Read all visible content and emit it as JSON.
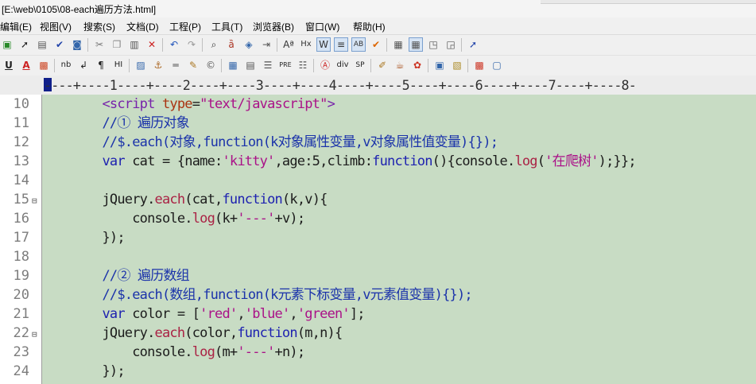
{
  "window": {
    "title": "[E:\\web\\0105\\08-each遍历方法.html]"
  },
  "menu": [
    "编辑(E)",
    "视图(V)",
    "搜索(S)",
    "文档(D)",
    "工程(P)",
    "工具(T)",
    "浏览器(B)",
    "窗口(W)",
    "帮助(H)"
  ],
  "toolbar_labels": {
    "nb": "nb",
    "p": "¶",
    "hi": "HI",
    "pre": "PRE",
    "div": "div",
    "sp": "SP",
    "a": "A",
    "u": "U",
    "hx": "Hx"
  },
  "ruler": "----+----1----+----2----+----3----+----4----+----5----+----6----+----7----+----8-",
  "line_numbers": [
    "10",
    "11",
    "12",
    "13",
    "14",
    "15",
    "16",
    "17",
    "18",
    "19",
    "20",
    "21",
    "22",
    "23",
    "24"
  ],
  "code": {
    "l10_open": "<script",
    "l10_attr": "type",
    "l10_eq": "=",
    "l10_val": "\"text/javascript\"",
    "l10_close": ">",
    "l11": "//① 遍历对象",
    "l12": "//$.each(对象,function(k对象属性变量,v对象属性值变量){});",
    "l13_kw": "var",
    "l13_a": " cat = {name:",
    "l13_s1": "'kitty'",
    "l13_b": ",age:5,climb:",
    "l13_kw2": "function",
    "l13_c": "(){console.",
    "l13_fn": "log",
    "l13_d": "(",
    "l13_s2": "'在爬树'",
    "l13_e": ");}};",
    "l15_a": "jQuery.",
    "l15_fn": "each",
    "l15_b": "(cat,",
    "l15_kw": "function",
    "l15_c": "(k,v){",
    "l16_a": "console.",
    "l16_fn": "log",
    "l16_b": "(k+",
    "l16_s": "'---'",
    "l16_c": "+v);",
    "l17": "});",
    "l19": "//② 遍历数组",
    "l20": "//$.each(数组,function(k元素下标变量,v元素值变量){});",
    "l21_kw": "var",
    "l21_a": " color = [",
    "l21_s1": "'red'",
    "l21_c1": ",",
    "l21_s2": "'blue'",
    "l21_c2": ",",
    "l21_s3": "'green'",
    "l21_b": "];",
    "l22_a": "jQuery.",
    "l22_fn": "each",
    "l22_b": "(color,",
    "l22_kw": "function",
    "l22_c": "(m,n){",
    "l23_a": "console.",
    "l23_fn": "log",
    "l23_b": "(m+",
    "l23_s": "'---'",
    "l23_c": "+n);",
    "l24": "});"
  }
}
